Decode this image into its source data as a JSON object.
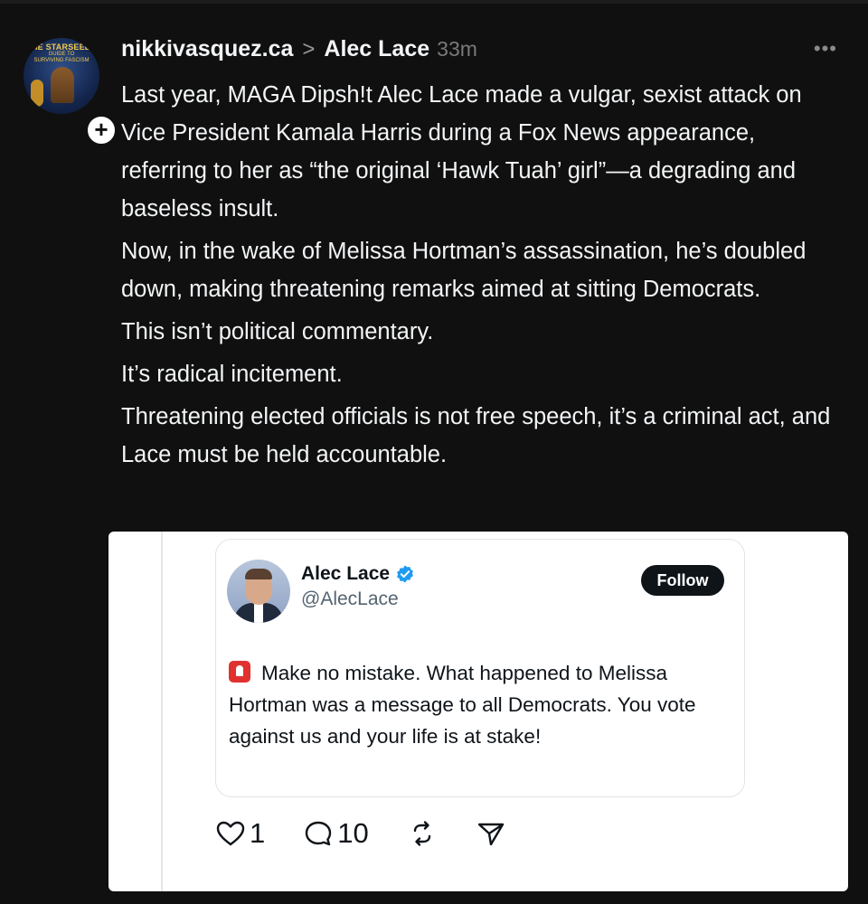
{
  "header": {
    "site": "nikkivasquez.ca",
    "separator": ">",
    "topic": "Alec Lace",
    "time": "33m",
    "more_icon": "ellipsis-icon"
  },
  "avatar": {
    "title": "THE STARSEEDS",
    "subtitle_line1": "GUIDE TO",
    "subtitle_line2": "SURVIVING FASCISM",
    "follow_badge": "+"
  },
  "post": {
    "paragraphs": [
      "Last year, MAGA Dipsh!t Alec Lace made a vulgar, sexist attack on Vice President Kamala Harris during a Fox News appearance, referring to her as “the original ‘Hawk Tuah’ girl”—a degrading and baseless insult.",
      "Now, in the wake of Melissa Hortman’s assassination, he’s doubled down, making threatening remarks aimed at sitting Democrats.",
      "This isn’t political commentary.",
      "It’s radical incitement.",
      "Threatening elected officials is not free speech, it’s a criminal act, and Lace must be held accountable."
    ]
  },
  "embedded_tweet": {
    "name": "Alec Lace",
    "handle": "@AlecLace",
    "follow_label": "Follow",
    "text": "Make no mistake.  What happened to Melissa Hortman was a message to all Democrats.  You vote against us and your life is at stake!",
    "verified_color": "#1d9bf0"
  },
  "actions": {
    "likes": "1",
    "replies": "10"
  },
  "colors": {
    "background": "#101010",
    "text": "#f3f5f7",
    "muted": "#7a7a7a"
  }
}
